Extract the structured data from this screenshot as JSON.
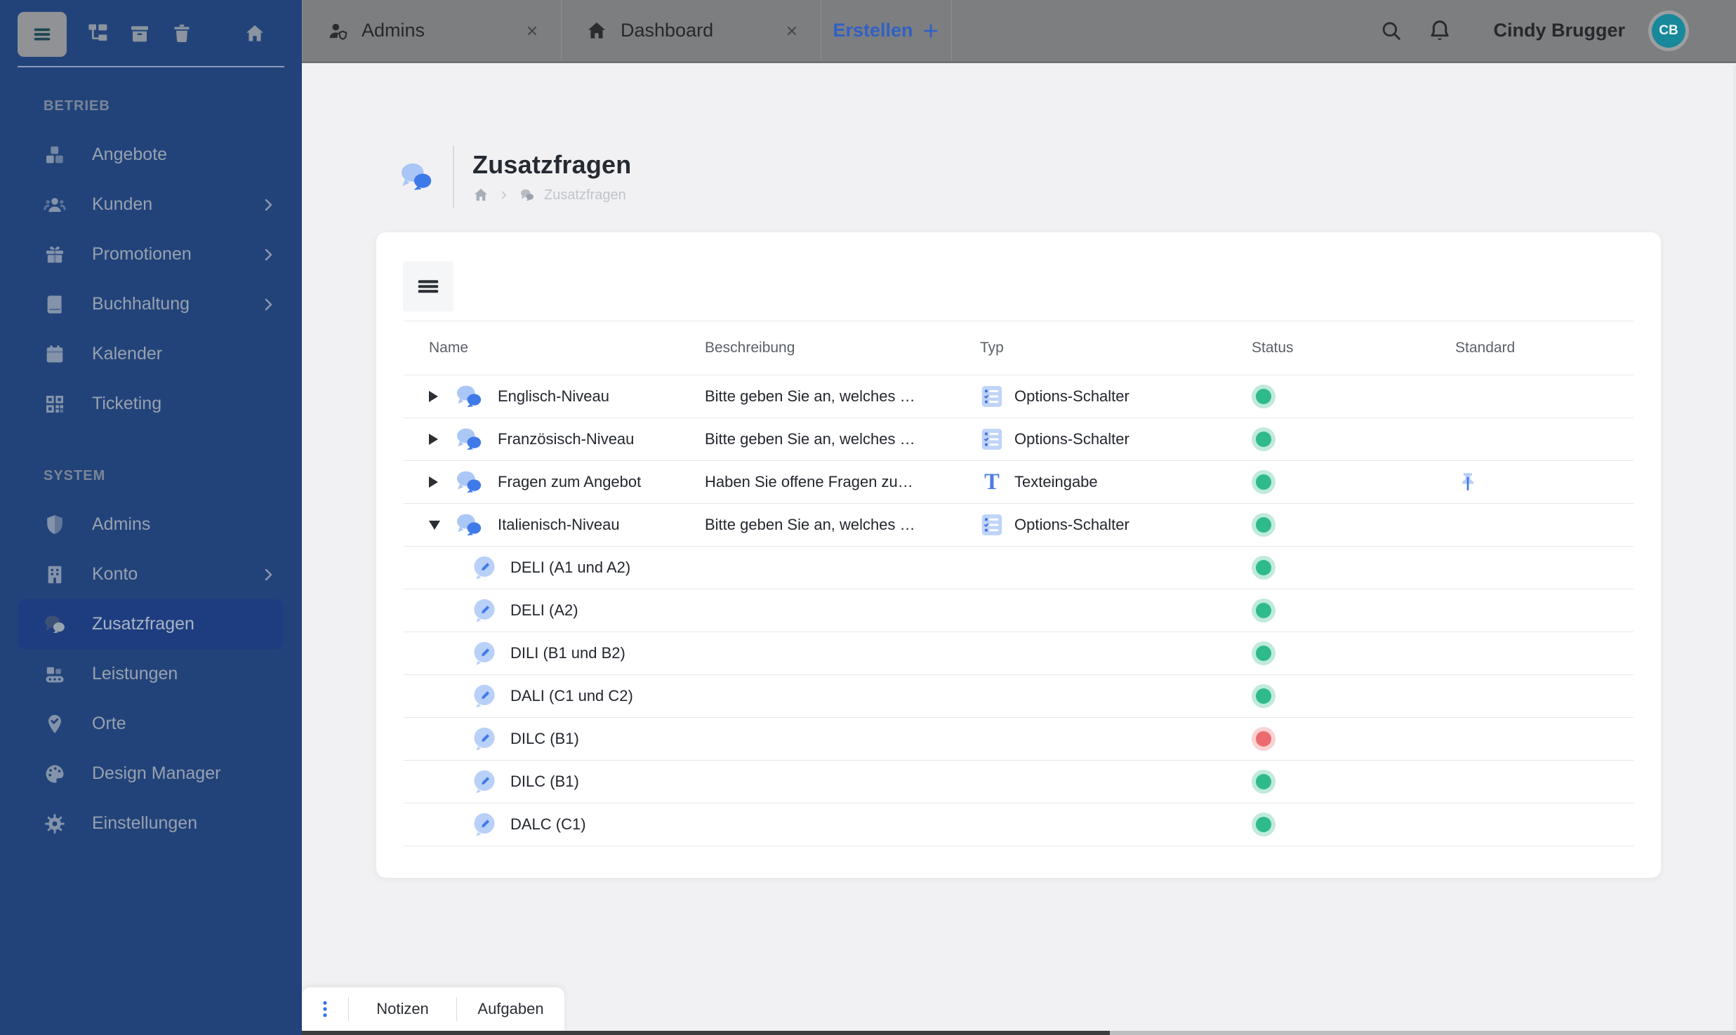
{
  "topbar": {
    "tabs": [
      {
        "label": "Admins",
        "icon": "user-badge-icon",
        "closable": true
      },
      {
        "label": "Dashboard",
        "icon": "home-icon",
        "closable": true
      }
    ],
    "create_tab_label": "Erstellen",
    "user_name": "Cindy Brugger",
    "avatar_initials": "CB"
  },
  "sidebar": {
    "toolbar": [
      "menu-icon",
      "folder-tree-icon",
      "archive-icon",
      "trash-icon",
      "home-icon"
    ],
    "sections": [
      {
        "title": "BETRIEB",
        "items": [
          {
            "label": "Angebote",
            "icon": "cubes-icon",
            "chevron": false,
            "active": false
          },
          {
            "label": "Kunden",
            "icon": "users-icon",
            "chevron": true,
            "active": false
          },
          {
            "label": "Promotionen",
            "icon": "gift-icon",
            "chevron": true,
            "active": false
          },
          {
            "label": "Buchhaltung",
            "icon": "book-icon",
            "chevron": true,
            "active": false
          },
          {
            "label": "Kalender",
            "icon": "calendar-icon",
            "chevron": false,
            "active": false
          },
          {
            "label": "Ticketing",
            "icon": "qr-icon",
            "chevron": false,
            "active": false
          }
        ]
      },
      {
        "title": "SYSTEM",
        "items": [
          {
            "label": "Admins",
            "icon": "shield-icon",
            "chevron": false,
            "active": false
          },
          {
            "label": "Konto",
            "icon": "building-icon",
            "chevron": true,
            "active": false
          },
          {
            "label": "Zusatzfragen",
            "icon": "chat-icon",
            "chevron": false,
            "active": true
          },
          {
            "label": "Leistungen",
            "icon": "conveyor-icon",
            "chevron": false,
            "active": false
          },
          {
            "label": "Orte",
            "icon": "pin-check-icon",
            "chevron": false,
            "active": false
          },
          {
            "label": "Design Manager",
            "icon": "palette-icon",
            "chevron": false,
            "active": false
          },
          {
            "label": "Einstellungen",
            "icon": "gear-icon",
            "chevron": false,
            "active": false
          }
        ]
      }
    ]
  },
  "page": {
    "title": "Zusatzfragen",
    "breadcrumb_current": "Zusatzfragen"
  },
  "table": {
    "columns": [
      "Name",
      "Beschreibung",
      "Typ",
      "Status",
      "Standard"
    ],
    "rows": [
      {
        "name": "Englisch-Niveau",
        "description": "Bitte geben Sie an, welches …",
        "type": "Options-Schalter",
        "type_icon": "options-list-icon",
        "status": "green",
        "standard": false,
        "expanded": false,
        "children": []
      },
      {
        "name": "Französisch-Niveau",
        "description": "Bitte geben Sie an, welches …",
        "type": "Options-Schalter",
        "type_icon": "options-list-icon",
        "status": "green",
        "standard": false,
        "expanded": false,
        "children": []
      },
      {
        "name": "Fragen zum Angebot",
        "description": "Haben Sie offene Fragen zu…",
        "type": "Texteingabe",
        "type_icon": "text-input-icon",
        "status": "green",
        "standard": true,
        "expanded": false,
        "children": []
      },
      {
        "name": "Italienisch-Niveau",
        "description": "Bitte geben Sie an, welches …",
        "type": "Options-Schalter",
        "type_icon": "options-list-icon",
        "status": "green",
        "standard": false,
        "expanded": true,
        "children": [
          {
            "name": "DELI (A1 und A2)",
            "status": "green"
          },
          {
            "name": "DELI (A2)",
            "status": "green"
          },
          {
            "name": "DILI (B1 und B2)",
            "status": "green"
          },
          {
            "name": "DALI (C1 und C2)",
            "status": "green"
          },
          {
            "name": "DILC (B1)",
            "status": "red"
          },
          {
            "name": "DILC (B1)",
            "status": "green"
          },
          {
            "name": "DALC (C1)",
            "status": "green"
          }
        ]
      }
    ]
  },
  "bottombar": {
    "items": [
      "Notizen",
      "Aufgaben"
    ]
  },
  "colors": {
    "sidebar_bg": "#22437a",
    "sidebar_active_bg": "#1d3d80",
    "topbar_bg": "#7d7e80",
    "accent_blue": "#3f7ae8",
    "create_tab_blue": "#3061c4",
    "status_green": "#2eba8c",
    "status_red": "#ec6a6e",
    "avatar_teal": "#18889b"
  }
}
